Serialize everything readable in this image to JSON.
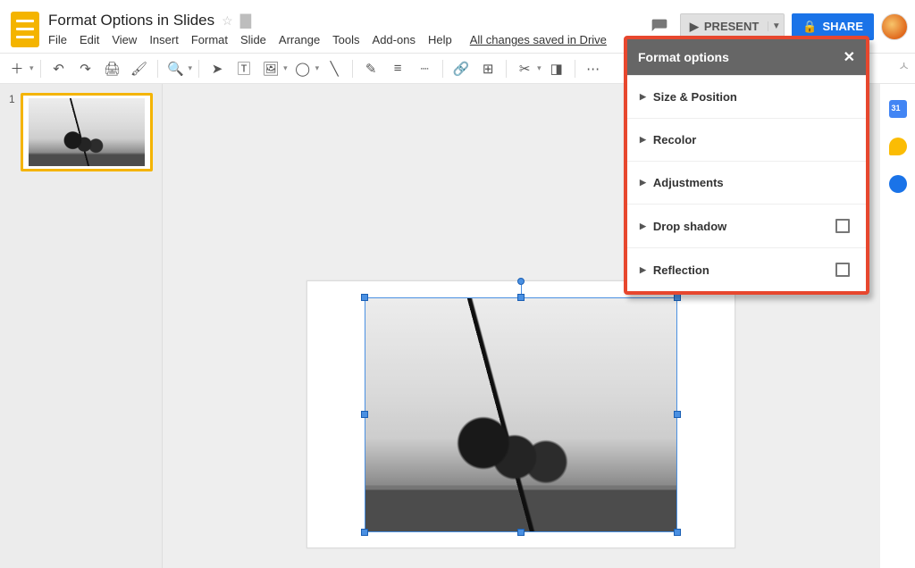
{
  "doc": {
    "title": "Format Options in Slides",
    "save_state": "All changes saved in Drive"
  },
  "menubar": {
    "file": "File",
    "edit": "Edit",
    "view": "View",
    "insert": "Insert",
    "format": "Format",
    "slide": "Slide",
    "arrange": "Arrange",
    "tools": "Tools",
    "addons": "Add-ons",
    "help": "Help"
  },
  "header": {
    "present": "PRESENT",
    "share": "SHARE"
  },
  "filmstrip": {
    "slide1_num": "1"
  },
  "panel": {
    "title": "Format options",
    "sections": {
      "size_position": "Size & Position",
      "recolor": "Recolor",
      "adjustments": "Adjustments",
      "drop_shadow": "Drop shadow",
      "reflection": "Reflection"
    }
  }
}
